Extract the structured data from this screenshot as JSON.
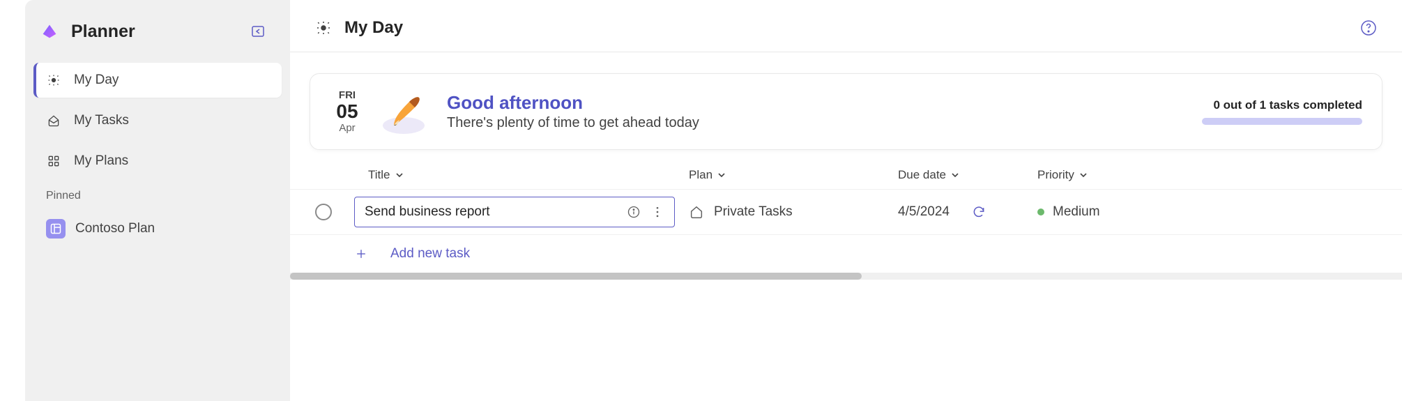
{
  "app": {
    "title": "Planner"
  },
  "nav": {
    "items": [
      {
        "label": "My Day"
      },
      {
        "label": "My Tasks"
      },
      {
        "label": "My Plans"
      }
    ],
    "pinned_label": "Pinned",
    "pinned": [
      {
        "label": "Contoso Plan"
      }
    ]
  },
  "header": {
    "title": "My Day"
  },
  "banner": {
    "dow": "FRI",
    "day": "05",
    "month": "Apr",
    "greeting": "Good afternoon",
    "subtitle": "There's plenty of time to get ahead today",
    "progress_text": "0 out of 1 tasks completed"
  },
  "columns": {
    "title": "Title",
    "plan": "Plan",
    "due": "Due date",
    "priority": "Priority"
  },
  "tasks": [
    {
      "title": "Send business report",
      "plan": "Private Tasks",
      "due": "4/5/2024",
      "priority": "Medium"
    }
  ],
  "add_task_label": "Add new task"
}
